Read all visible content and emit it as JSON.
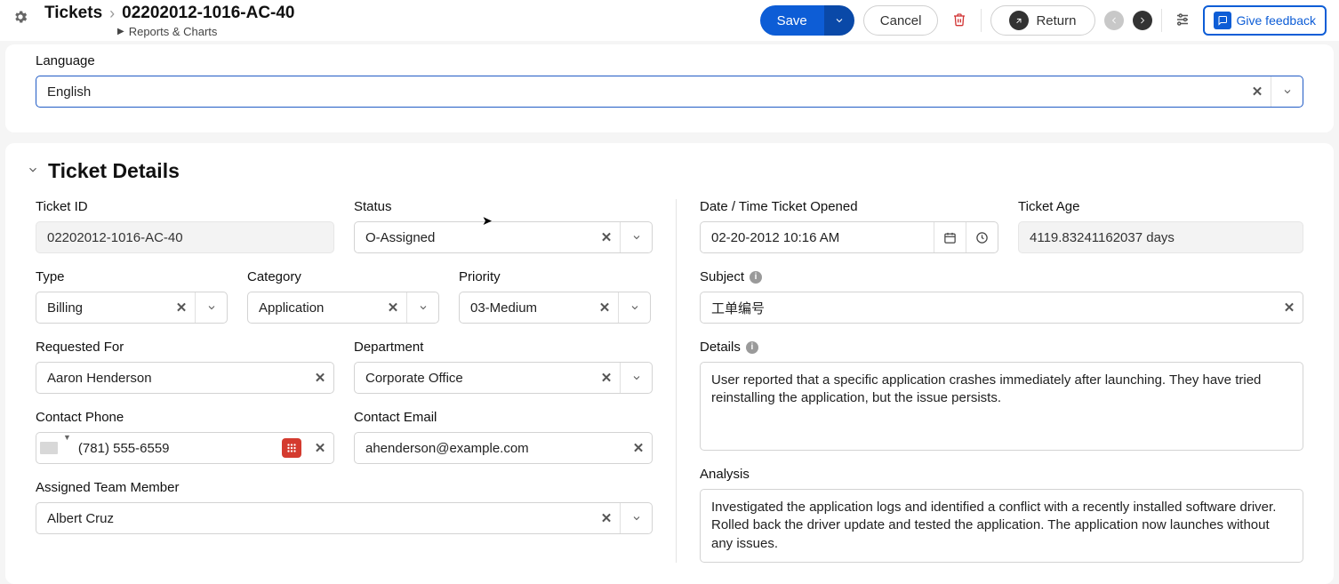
{
  "header": {
    "breadcrumb_root": "Tickets",
    "breadcrumb_current": "02202012-1016-AC-40",
    "reports_link": "Reports & Charts",
    "save_label": "Save",
    "cancel_label": "Cancel",
    "return_label": "Return",
    "feedback_label": "Give feedback"
  },
  "language": {
    "label": "Language",
    "value": "English"
  },
  "section": {
    "title": "Ticket Details"
  },
  "left": {
    "ticket_id_label": "Ticket ID",
    "ticket_id": "02202012-1016-AC-40",
    "status_label": "Status",
    "status": "O-Assigned",
    "type_label": "Type",
    "type": "Billing",
    "category_label": "Category",
    "category": "Application",
    "priority_label": "Priority",
    "priority": "03-Medium",
    "requested_for_label": "Requested For",
    "requested_for": "Aaron Henderson",
    "department_label": "Department",
    "department": "Corporate Office",
    "contact_phone_label": "Contact Phone",
    "contact_phone": "(781) 555-6559",
    "contact_email_label": "Contact Email",
    "contact_email": "ahenderson@example.com",
    "assigned_label": "Assigned Team Member",
    "assigned": "Albert Cruz"
  },
  "right": {
    "date_opened_label": "Date / Time Ticket Opened",
    "date_opened": "02-20-2012 10:16 AM",
    "ticket_age_label": "Ticket Age",
    "ticket_age": "4119.83241162037 days",
    "subject_label": "Subject",
    "subject": "工单编号",
    "details_label": "Details",
    "details": "User reported that a specific application crashes immediately after launching. They have tried reinstalling the application, but the issue persists.",
    "analysis_label": "Analysis",
    "analysis": "Investigated the application logs and identified a conflict with a recently installed software driver. Rolled back the driver update and tested the application. The application now launches without any issues."
  }
}
